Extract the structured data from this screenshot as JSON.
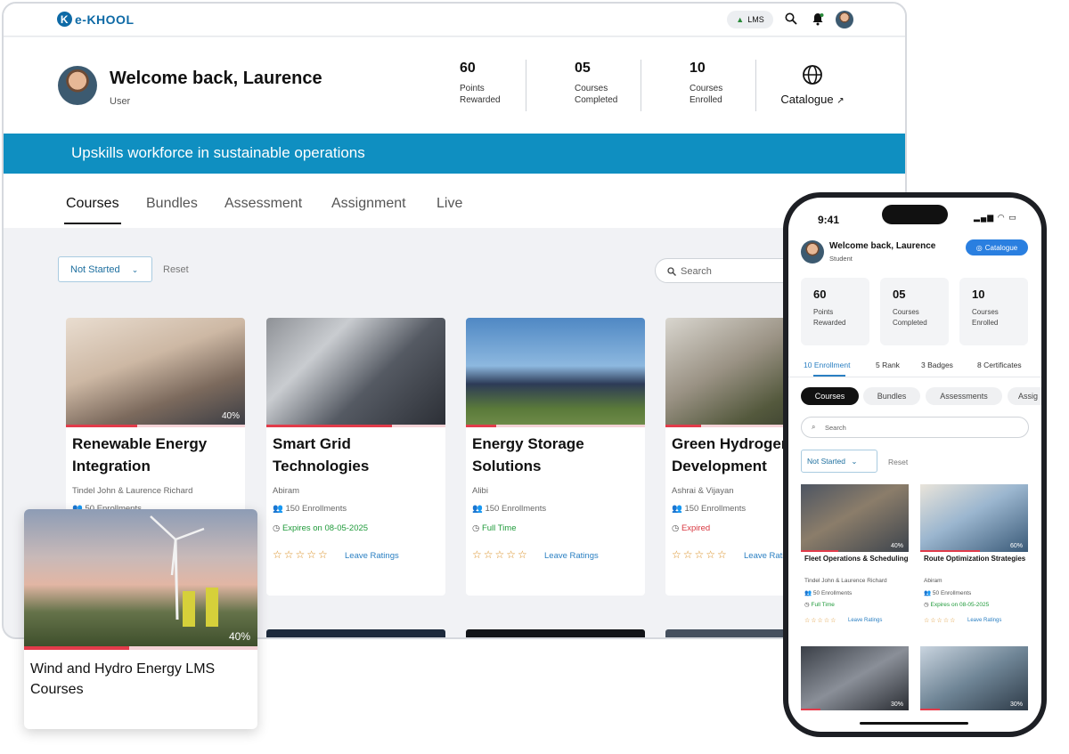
{
  "app": {
    "logo_text": "e-KHOOL",
    "logo_letter": "K",
    "lms_label": "LMS"
  },
  "colors": {
    "brand": "#0e6aa6",
    "banner": "#0f8fc1",
    "progress": "#e23b4a",
    "star": "#d98c1e",
    "link": "#2a7fc2",
    "success": "#1f9a3a",
    "danger": "#d8363f"
  },
  "welcome": {
    "title": "Welcome back, Laurence",
    "role": "User"
  },
  "stats": [
    {
      "value": "60",
      "label1": "Points",
      "label2": "Rewarded"
    },
    {
      "value": "05",
      "label1": "Courses",
      "label2": "Completed"
    },
    {
      "value": "10",
      "label1": "Courses",
      "label2": "Enrolled"
    }
  ],
  "catalogue": {
    "label": "Catalogue",
    "arrow": "↗"
  },
  "banner": {
    "text": "Upskills workforce in sustainable operations"
  },
  "tabs": [
    "Courses",
    "Bundles",
    "Assessment",
    "Assignment",
    "Live"
  ],
  "filters": {
    "status": "Not Started",
    "reset": "Reset",
    "search_placeholder": "Search"
  },
  "courses": [
    {
      "title": "Renewable Energy Integration",
      "authors": "Tindel John & Laurence Richard",
      "enrollments": "50 Enrollments",
      "progress_pct": "40%",
      "progress": 0.4
    },
    {
      "title": "Smart Grid Technologies",
      "authors": "Abiram",
      "enrollments": "150 Enrollments",
      "status": "Expires on 08-05-2025",
      "status_type": "success",
      "progress": 0.7
    },
    {
      "title": "Energy Storage Solutions",
      "authors": "Alibi",
      "enrollments": "150 Enrollments",
      "status": "Full Time",
      "status_type": "success",
      "progress": 0.17
    },
    {
      "title": "Green Hydrogen Development",
      "authors": "Ashrai & Vijayan",
      "enrollments": "150 Enrollments",
      "status": "Expired",
      "status_type": "danger",
      "progress": 0.2
    }
  ],
  "leave_ratings": "Leave Ratings",
  "stars": "☆☆☆☆☆",
  "featured": {
    "title": "Wind and Hydro Energy LMS Courses",
    "progress_pct": "40%",
    "progress": 0.45
  },
  "mobile": {
    "time": "9:41",
    "welcome": "Welcome back, Laurence",
    "role": "Student",
    "catalogue": "Catalogue",
    "stats": [
      {
        "value": "60",
        "label1": "Points",
        "label2": "Rewarded"
      },
      {
        "value": "05",
        "label1": "Courses",
        "label2": "Completed"
      },
      {
        "value": "10",
        "label1": "Courses",
        "label2": "Enrolled"
      }
    ],
    "subtabs": [
      "10 Enrollment",
      "5 Rank",
      "3 Badges",
      "8 Certificates"
    ],
    "pills": [
      "Courses",
      "Bundles",
      "Assessments",
      "Assig"
    ],
    "search_placeholder": "Search",
    "filter": "Not Started",
    "reset": "Reset",
    "cards": [
      {
        "title": "Fleet Operations & Scheduling",
        "authors": "Tindel John & Laurence Richard",
        "enrollments": "50 Enrollments",
        "status": "Full Time",
        "pct": "40%",
        "progress": 0.35
      },
      {
        "title": "Route Optimization Strategies",
        "authors": "Abiram",
        "enrollments": "50 Enrollments",
        "status": "Expires on 08-05-2025",
        "pct": "60%",
        "progress": 0.55
      },
      {
        "pct": "30%",
        "progress": 0.18
      },
      {
        "pct": "30%",
        "progress": 0.18
      }
    ],
    "leave_ratings": "Leave Ratings"
  }
}
